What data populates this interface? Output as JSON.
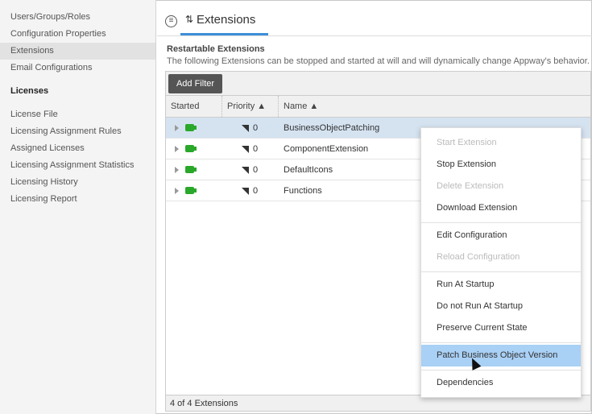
{
  "sidebar": {
    "items": [
      "Users/Groups/Roles",
      "Configuration Properties",
      "Extensions",
      "Email Configurations"
    ],
    "section": "Licenses",
    "license_items": [
      "License File",
      "Licensing Assignment Rules",
      "Assigned Licenses",
      "Licensing Assignment Statistics",
      "Licensing History",
      "Licensing Report"
    ]
  },
  "header": {
    "tab": "Extensions"
  },
  "section": {
    "title": "Restartable Extensions",
    "description": "The following Extensions can be stopped and started at will and will dynamically change Appway's behavior."
  },
  "grid": {
    "add_filter": "Add Filter",
    "columns": [
      "Started",
      "Priority ▲",
      "Name ▲"
    ],
    "rows": [
      {
        "priority": "0",
        "name": "BusinessObjectPatching"
      },
      {
        "priority": "0",
        "name": "ComponentExtension"
      },
      {
        "priority": "0",
        "name": "DefaultIcons"
      },
      {
        "priority": "0",
        "name": "Functions"
      }
    ],
    "footer": "4 of 4 Extensions"
  },
  "context_menu": [
    "Start Extension",
    "Stop Extension",
    "Delete Extension",
    "Download Extension",
    "Edit Configuration",
    "Reload Configuration",
    "Run At Startup",
    "Do not Run At Startup",
    "Preserve Current State",
    "Patch Business Object Version",
    "Dependencies"
  ]
}
